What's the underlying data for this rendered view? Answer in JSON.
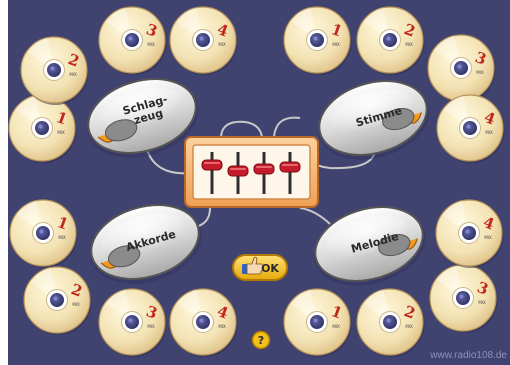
{
  "players": [
    {
      "id": "schlagzeug",
      "label_lines": [
        "Schlag-",
        "zeug"
      ]
    },
    {
      "id": "stimme",
      "label_lines": [
        "Stimme"
      ]
    },
    {
      "id": "akkorde",
      "label_lines": [
        "Akkorde"
      ]
    },
    {
      "id": "melodie",
      "label_lines": [
        "Melodie"
      ]
    }
  ],
  "cds": {
    "schlagzeug": [
      "1",
      "2",
      "3",
      "4"
    ],
    "stimme": [
      "1",
      "2",
      "3",
      "4"
    ],
    "akkorde": [
      "1",
      "2",
      "3",
      "4"
    ],
    "melodie": [
      "1",
      "2",
      "3",
      "4"
    ]
  },
  "cd_tiny_label": "MIX",
  "mixer": {
    "sliders": 4
  },
  "ok_button": {
    "label": "OK",
    "icon": "thumbs-up-icon"
  },
  "help_button": {
    "label": "?"
  },
  "watermark": "www.radio108.de",
  "colors": {
    "background": "#40426f",
    "cd_fill": "#f3e2b3",
    "cd_hub": "#3a3d76",
    "cd_number": "#c0281c",
    "mixer_frame": "#f6b36e",
    "slider_knob": "#c41c2a",
    "ok_fill": "#f2c11c"
  }
}
